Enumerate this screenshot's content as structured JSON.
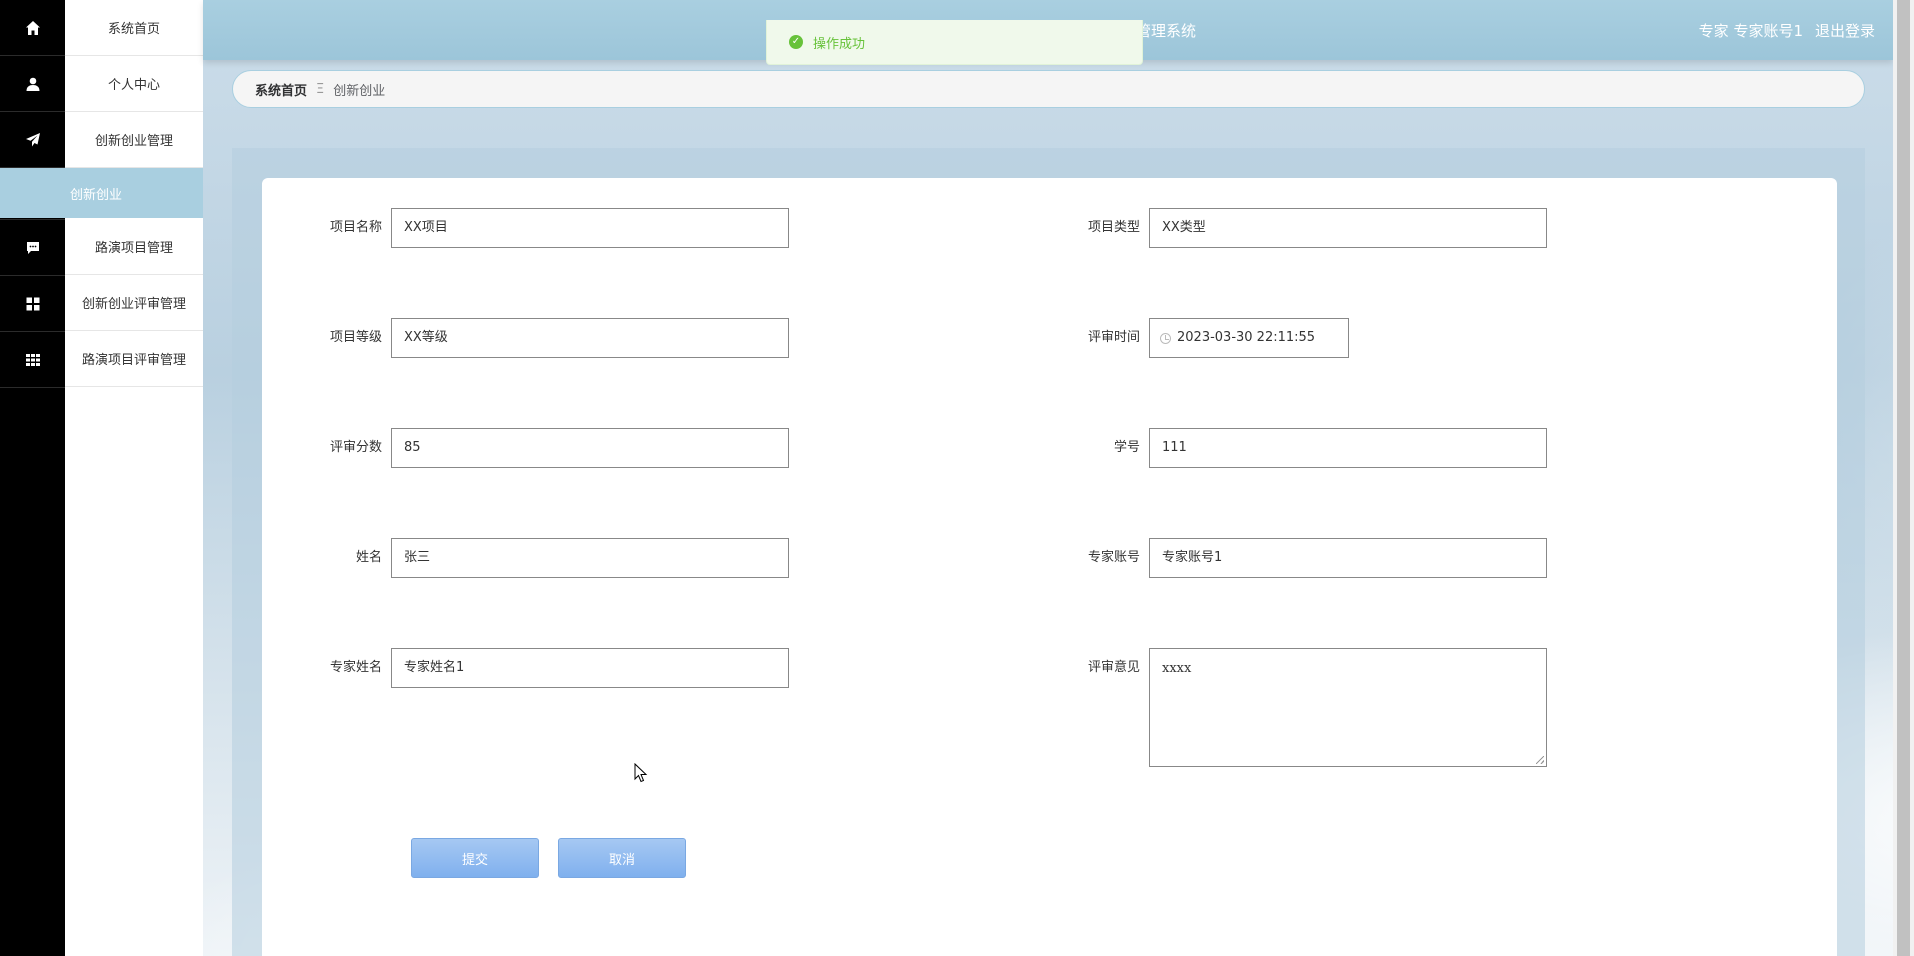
{
  "header": {
    "title": "管理系统",
    "role": "专家",
    "username": "专家账号1",
    "logout_label": "退出登录"
  },
  "toast": {
    "message": "操作成功",
    "color": "#67c23a"
  },
  "sidebar": {
    "items": [
      {
        "label": "系统首页",
        "icon": "home-icon"
      },
      {
        "label": "个人中心",
        "icon": "user-icon"
      },
      {
        "label": "创新创业管理",
        "icon": "paper-plane-icon"
      },
      {
        "label": "路演项目管理",
        "icon": "chat-icon"
      },
      {
        "label": "创新创业评审管理",
        "icon": "grid-icon"
      },
      {
        "label": "路演项目评审管理",
        "icon": "table-icon"
      }
    ],
    "active_sub": "创新创业",
    "accent_color": "#a9cfe0"
  },
  "breadcrumb": {
    "home": "系统首页",
    "separator": "Ξ",
    "current": "创新创业"
  },
  "form": {
    "project_name": {
      "label": "项目名称",
      "value": "XX项目"
    },
    "project_type": {
      "label": "项目类型",
      "value": "XX类型"
    },
    "project_level": {
      "label": "项目等级",
      "value": "XX等级"
    },
    "review_time": {
      "label": "评审时间",
      "value": "2023-03-30 22:11:55"
    },
    "review_score": {
      "label": "评审分数",
      "value": "85"
    },
    "student_id": {
      "label": "学号",
      "value": "111"
    },
    "name": {
      "label": "姓名",
      "value": "张三"
    },
    "expert_account": {
      "label": "专家账号",
      "value": "专家账号1"
    },
    "expert_name": {
      "label": "专家姓名",
      "value": "专家姓名1"
    },
    "review_comment": {
      "label": "评审意见",
      "value": "xxxx"
    }
  },
  "buttons": {
    "submit": "提交",
    "cancel": "取消"
  }
}
